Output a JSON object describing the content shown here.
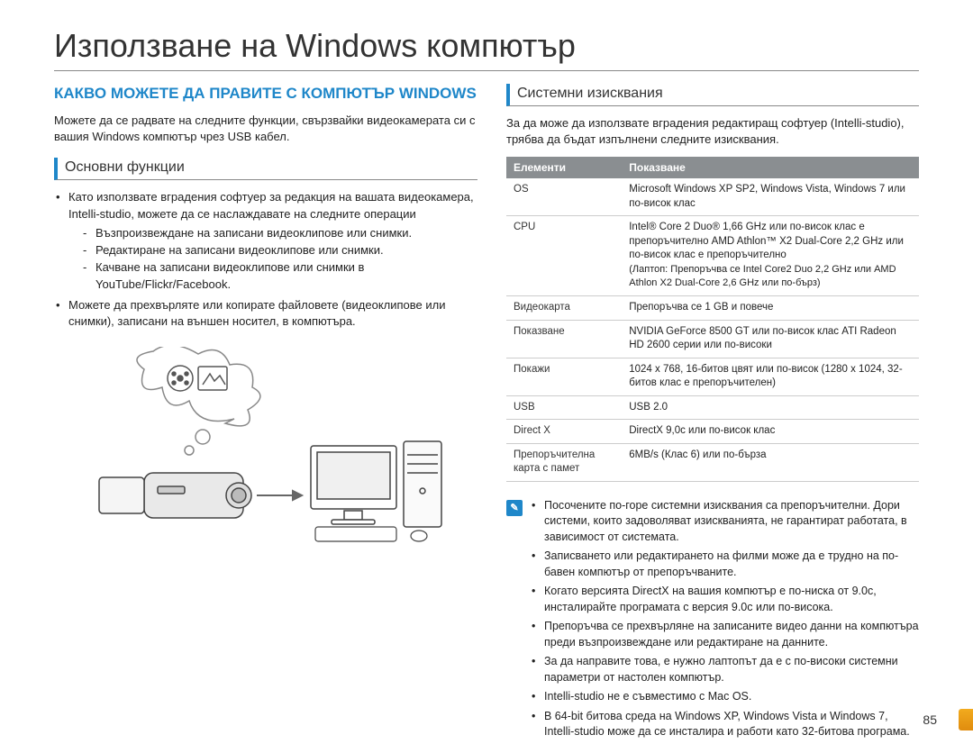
{
  "page": {
    "title": "Използване на Windows компютър",
    "number": "85"
  },
  "left": {
    "heading": "КАКВО МОЖЕТЕ ДА ПРАВИТЕ С КОМПЮТЪР WINDOWS",
    "intro": "Можете да се радвате на следните функции, свързвайки видеокамерата си с вашия Windows компютър чрез USB кабел.",
    "sub": "Основни функции",
    "b1": "Като използвате вградения софтуер за редакция на вашата видеокамера, Intelli-studio, можете да се наслаждавате на следните операции",
    "d1": "Възпроизвеждане на записани видеоклипове или снимки.",
    "d2": "Редактиране на записани видеоклипове или снимки.",
    "d3": "Качване на записани видеоклипове или снимки в YouTube/Flickr/Facebook.",
    "b2": "Можете да прехвърляте или копирате файловете (видеоклипове или снимки), записани на външен носител, в компютъра."
  },
  "right": {
    "sub": "Системни изисквания",
    "intro": "За да може да използвате вградения редактиращ софтуер (Intelli-studio), трябва да бъдат изпълнени следните изисквания.",
    "th1": "Елементи",
    "th2": "Показване",
    "rows": {
      "os_k": "OS",
      "os_v": "Microsoft Windows XP SP2, Windows Vista, Windows 7 или по-висок клас",
      "cpu_k": "CPU",
      "cpu_v1": "Intel® Core 2 Duo® 1,66 GHz или по-висок клас е препоръчително AMD Athlon™ X2 Dual-Core 2,2 GHz или по-висок клас е препоръчително",
      "cpu_v2": "(Лаптоп: Препоръчва се Intel Core2 Duo 2,2 GHz или AMD Athlon X2 Dual-Core 2,6 GHz или по-бърз)",
      "vid_k": "Видеокарта",
      "vid_v": "Препоръчва се 1 GB и повече",
      "disp_k": "Показване",
      "disp_v": "NVIDIA GeForce 8500 GT или по-висок клас ATI Radeon HD 2600 серии или по-високи",
      "show_k": "Покажи",
      "show_v": "1024 x 768, 16-битов цвят или по-висок (1280 x 1024, 32-битов клас е препоръчителен)",
      "usb_k": "USB",
      "usb_v": "USB 2.0",
      "dx_k": "Direct X",
      "dx_v": "DirectX 9,0c или по-висок клас",
      "mem_k": "Препоръчителна карта с памет",
      "mem_v": "6MB/s (Клас 6) или по-бърза"
    },
    "notes": {
      "n1": "Посочените по-горе системни изисквания са препоръчителни. Дори системи, които задоволяват изискванията, не гарантират работата, в зависимост от системата.",
      "n2": "Записването или редактирането на филми може да е трудно на по-бавен компютър от препоръчваните.",
      "n3": "Когато версията DirectX на вашия компютър е по-ниска от 9.0c, инсталирайте програмата с версия 9.0c или по-висока.",
      "n4": "Препоръчва се прехвърляне на записаните видео данни на компютъра преди възпроизвеждане или редактиране на данните.",
      "n5": "За да направите това, е нужно лаптопът да е с по-високи системни параметри от настолен компютър.",
      "n6": "Intelli-studio не е съвместимо с Mac OS.",
      "n7": "В 64-bit битова среда на Windows XP, Windows Vista и Windows 7, Intelli-studio може да се инсталира и работи като 32-битова програма."
    }
  }
}
